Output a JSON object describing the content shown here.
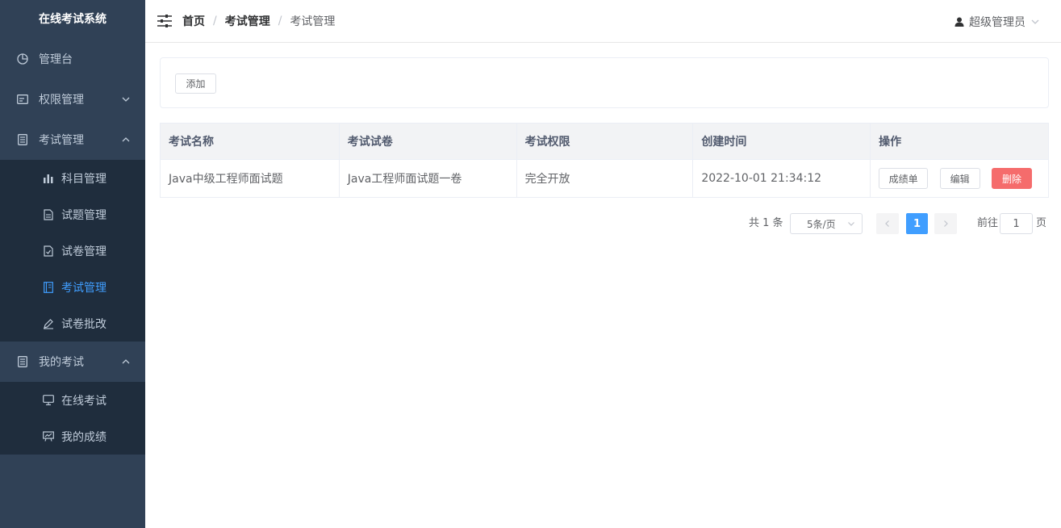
{
  "app": {
    "title": "在线考试系统"
  },
  "sidebar": {
    "items": [
      {
        "label": "管理台",
        "icon": "dashboard-icon"
      },
      {
        "label": "权限管理",
        "icon": "card-icon",
        "expanded": false
      },
      {
        "label": "考试管理",
        "icon": "document-icon",
        "expanded": true,
        "children": [
          {
            "label": "科目管理",
            "icon": "bar-chart-icon"
          },
          {
            "label": "试题管理",
            "icon": "file-text-icon"
          },
          {
            "label": "试卷管理",
            "icon": "file-check-icon"
          },
          {
            "label": "考试管理",
            "icon": "notebook-icon",
            "active": true
          },
          {
            "label": "试卷批改",
            "icon": "pencil-icon"
          }
        ]
      },
      {
        "label": "我的考试",
        "icon": "document-icon",
        "expanded": true,
        "children": [
          {
            "label": "在线考试",
            "icon": "monitor-icon"
          },
          {
            "label": "我的成绩",
            "icon": "board-icon"
          }
        ]
      }
    ]
  },
  "header": {
    "breadcrumb": [
      "首页",
      "考试管理",
      "考试管理"
    ],
    "separator": "/",
    "user": "超级管理员"
  },
  "toolbar": {
    "add_label": "添加"
  },
  "table": {
    "columns": [
      "考试名称",
      "考试试卷",
      "考试权限",
      "创建时间",
      "操作"
    ],
    "rows": [
      {
        "name": "Java中级工程师面试题",
        "paper": "Java工程师面试题一卷",
        "permission": "完全开放",
        "created": "2022-10-01 21:34:12"
      }
    ],
    "actions": {
      "score": "成绩单",
      "edit": "编辑",
      "delete": "删除"
    }
  },
  "pagination": {
    "total_text": "共 1 条",
    "page_size": "5条/页",
    "current_page": "1",
    "goto_label": "前往",
    "goto_value": "1",
    "page_suffix": "页"
  },
  "colors": {
    "sidebar_bg": "#304156",
    "submenu_bg": "#1f2d3d",
    "active": "#409eff",
    "danger": "#f56c6c"
  }
}
